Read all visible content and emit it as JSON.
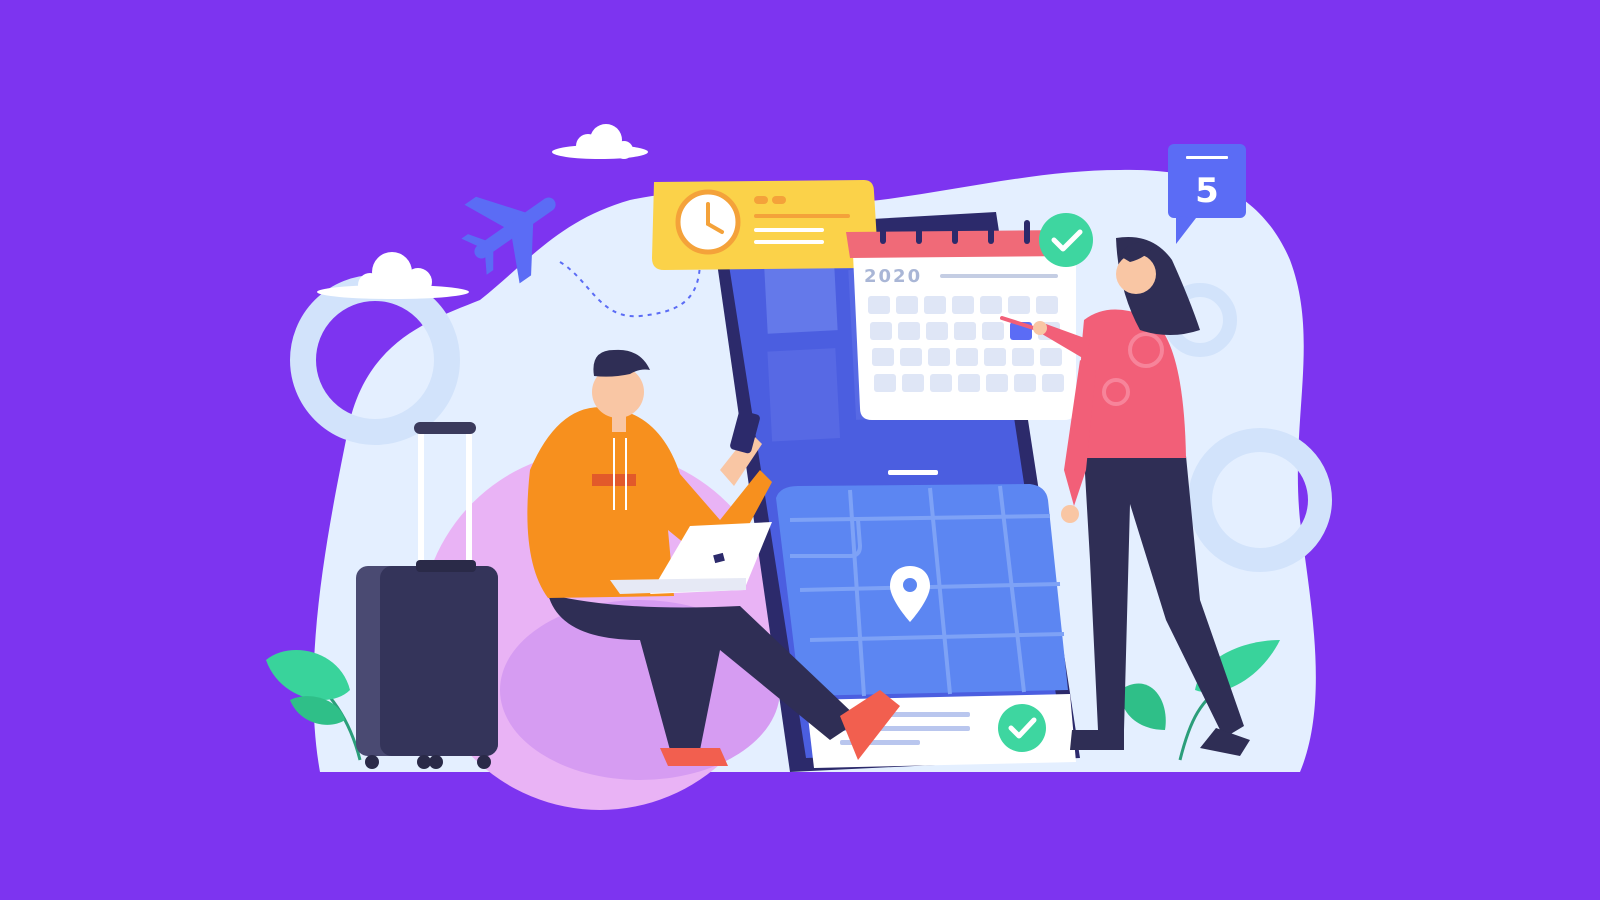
{
  "illustration": {
    "theme": "travel-booking",
    "colors": {
      "background": "#7d34f0",
      "blob": "#e4efff",
      "phone_body": "#2c2a6b",
      "phone_screen": "#4b5ee0",
      "map": "#5c86f2",
      "clock_card": "#fbd249",
      "calendar_header": "#f06a78",
      "check": "#3ed6a0",
      "hoodie": "#f7901e",
      "sweater": "#f25f78",
      "pants": "#2f2e55",
      "suitcase": "#3a3a5c",
      "leaf": "#39d39b",
      "airplane": "#5b6cf5"
    }
  },
  "calendar": {
    "year": "2020",
    "selected_cell": {
      "row": 1,
      "col": 5
    }
  },
  "notification_badge": {
    "count": "5"
  },
  "icons": {
    "airplane": "airplane-icon",
    "clock": "clock-icon",
    "check": "check-icon",
    "location_pin": "location-pin-icon",
    "cloud": "cloud-icon"
  }
}
